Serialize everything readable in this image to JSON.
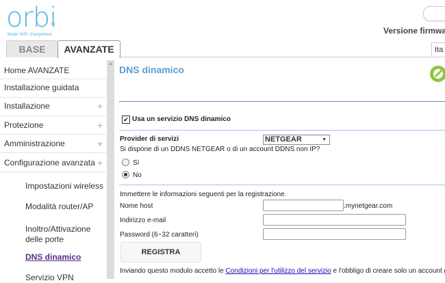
{
  "header": {
    "logo_text": "orbi",
    "logo_tm": "TM",
    "logo_tagline": "Better WiFi. Everywhere.",
    "firmware_label": "Versione firmwa",
    "language": "Ita"
  },
  "tabs": [
    {
      "label": "BASE"
    },
    {
      "label": "AVANZATE"
    }
  ],
  "sidebar": {
    "items": [
      {
        "label": "Home AVANZATE"
      },
      {
        "label": "Installazione guidata"
      },
      {
        "label": "Installazione",
        "expander": "+"
      },
      {
        "label": "Protezione",
        "expander": "+"
      },
      {
        "label": "Amministrazione",
        "expander": "+"
      },
      {
        "label": "Configurazione avanzata",
        "expander": "+"
      }
    ],
    "subitems": [
      {
        "label": "Impostazioni wireless"
      },
      {
        "label": "Modalità router/AP"
      },
      {
        "label": "Inoltro/Attivazione delle porte"
      },
      {
        "label": "DNS dinamico"
      },
      {
        "label": "Servizio VPN"
      }
    ]
  },
  "main": {
    "title": "DNS dinamico",
    "use_ddns_label": "Usa un servizio DNS dinamico",
    "provider_label": "Provider di servizi",
    "provider_value": "NETGEAR",
    "question": "Si dispone di un DDNS NETGEAR o di un account DDNS non IP?",
    "option_yes": "Sì",
    "option_no": "No",
    "register_info": "Immettere le informazioni seguenti per la registrazione.",
    "host_label": "Nome host",
    "host_suffix": ".mynetgear.com",
    "email_label": "Indirizzo e-mail",
    "password_label": "Password (6~32 caratteri)",
    "register_button": "REGISTRA",
    "terms_prefix": "Inviando questo modulo accetto le ",
    "terms_link": "Condizioni per l'utilizzo del servizio",
    "terms_suffix": " e l'obbligo di creare solo un account g"
  }
}
